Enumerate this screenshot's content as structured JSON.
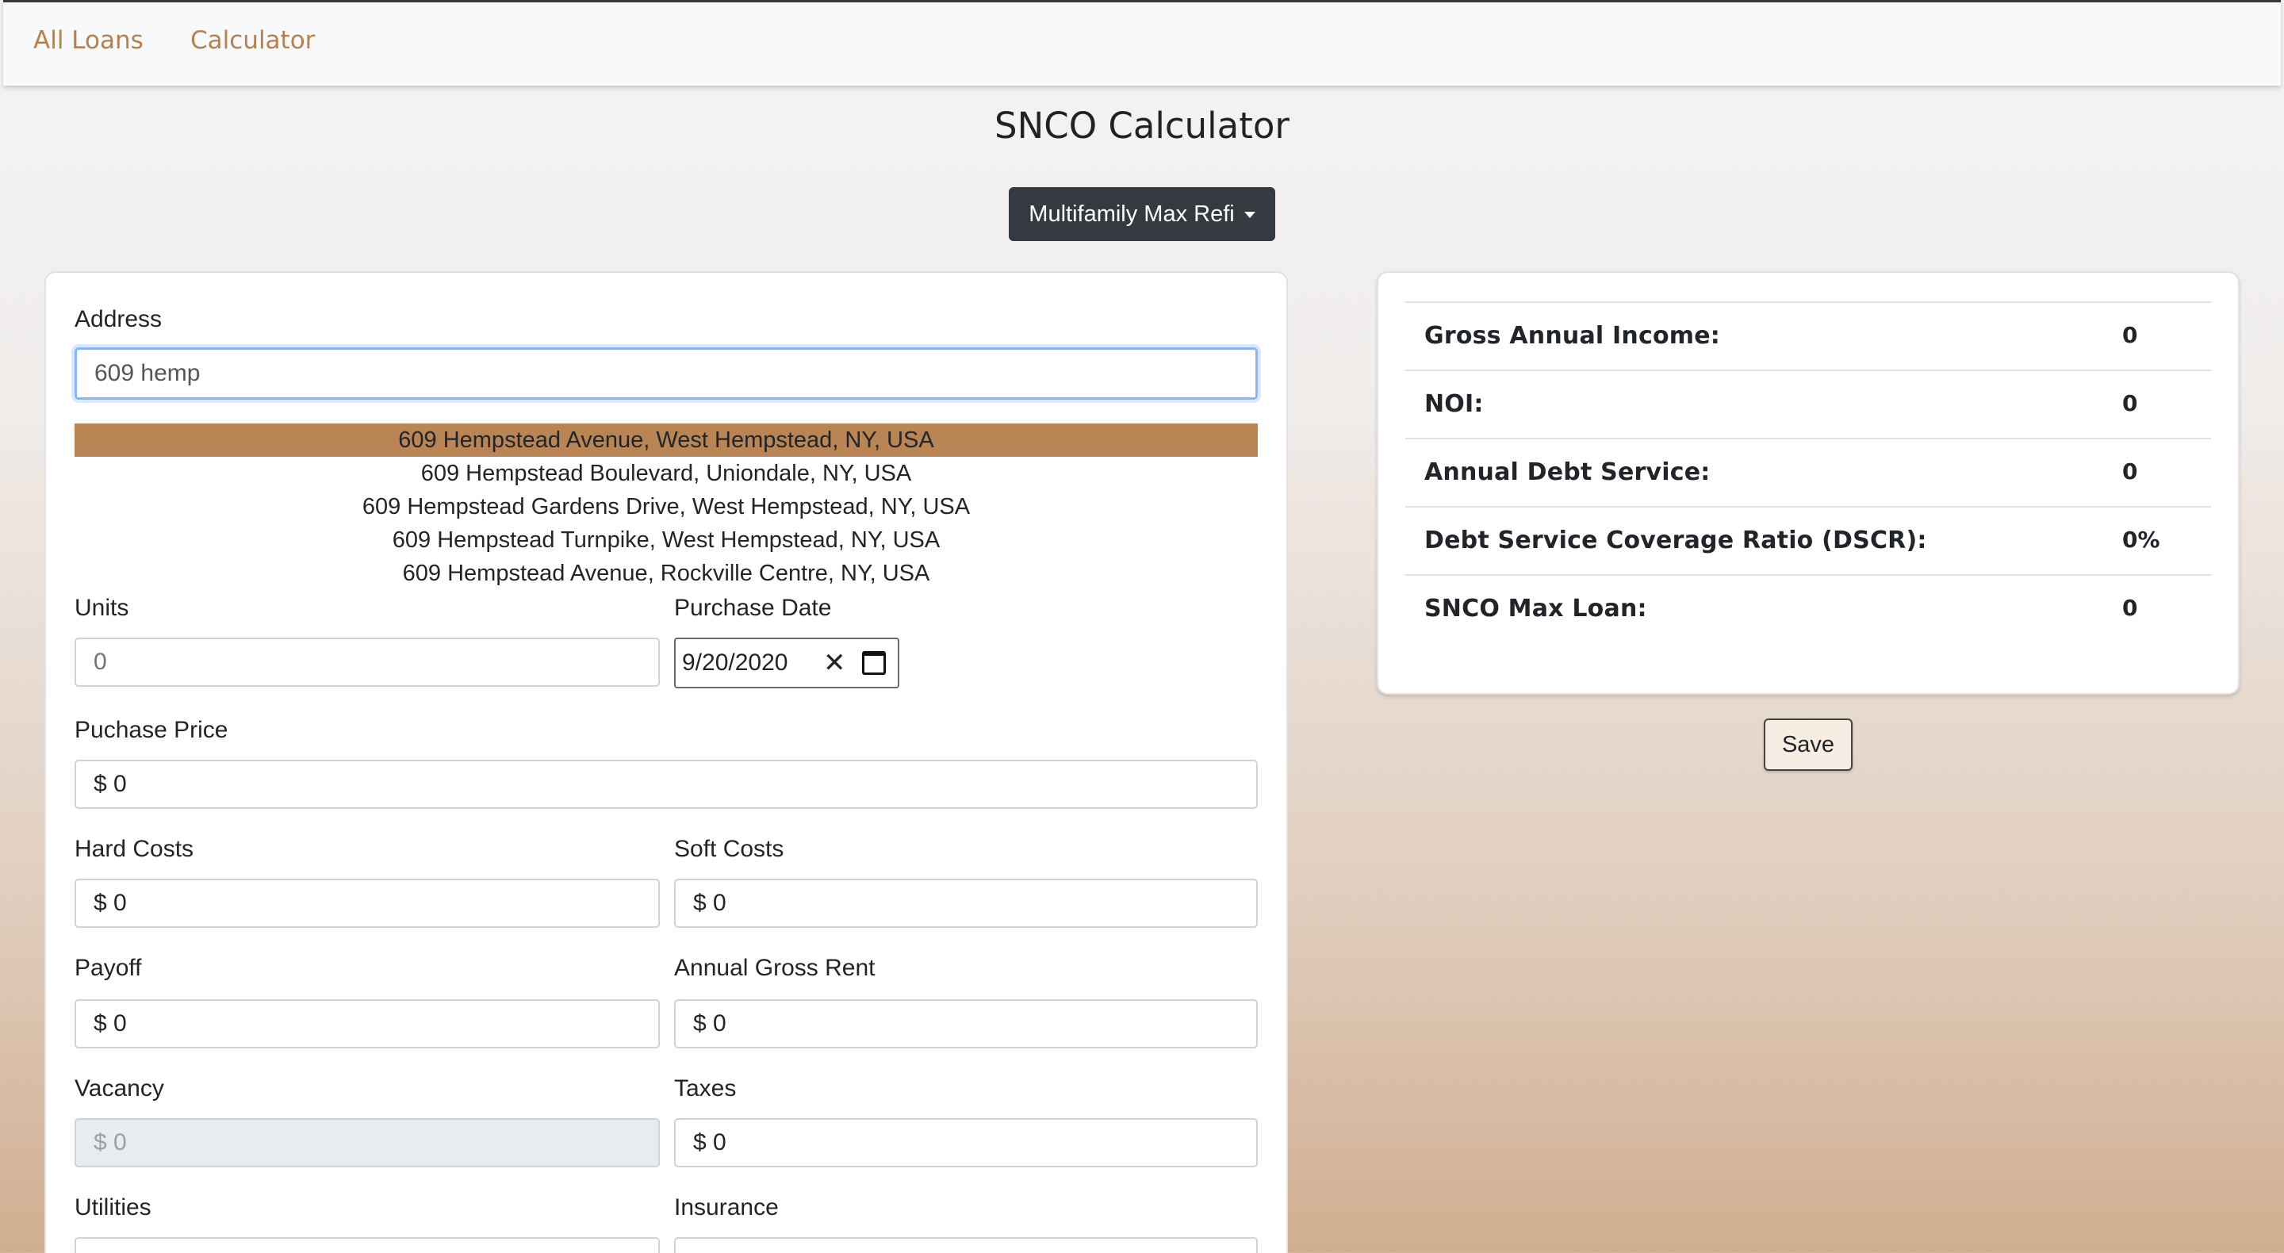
{
  "nav": {
    "items": [
      "All Loans",
      "Calculator"
    ]
  },
  "page": {
    "title": "SNCO Calculator"
  },
  "mode": {
    "label": "Multifamily Max Refi"
  },
  "form": {
    "address": {
      "label": "Address",
      "value": "609 hemp",
      "suggestions": [
        "609 Hempstead Avenue, West Hempstead, NY, USA",
        "609 Hempstead Boulevard, Uniondale, NY, USA",
        "609 Hempstead Gardens Drive, West Hempstead, NY, USA",
        "609 Hempstead Turnpike, West Hempstead, NY, USA",
        "609 Hempstead Avenue, Rockville Centre, NY, USA"
      ]
    },
    "units": {
      "label": "Units",
      "value": "0"
    },
    "purchase_date": {
      "label": "Purchase Date",
      "value": "9/20/2020"
    },
    "purchase_price": {
      "label": "Puchase Price",
      "value": "$ 0"
    },
    "hard_costs": {
      "label": "Hard Costs",
      "value": "$ 0"
    },
    "soft_costs": {
      "label": "Soft Costs",
      "value": "$ 0"
    },
    "payoff": {
      "label": "Payoff",
      "value": "$ 0"
    },
    "annual_gross_rent": {
      "label": "Annual Gross Rent",
      "value": "$ 0"
    },
    "vacancy": {
      "label": "Vacancy",
      "value": "$ 0"
    },
    "taxes": {
      "label": "Taxes",
      "value": "$ 0"
    },
    "utilities": {
      "label": "Utilities"
    },
    "insurance": {
      "label": "Insurance"
    }
  },
  "summary": {
    "rows": [
      {
        "label": "Gross Annual Income:",
        "value": "0"
      },
      {
        "label": "NOI:",
        "value": "0"
      },
      {
        "label": "Annual Debt Service:",
        "value": "0"
      },
      {
        "label": "Debt Service Coverage Ratio (DSCR):",
        "value": "0%"
      },
      {
        "label": "SNCO Max Loan:",
        "value": "0"
      }
    ]
  },
  "actions": {
    "save_label": "Save"
  },
  "colors": {
    "accent": "#b98555",
    "nav_link": "#b87f4f",
    "dark_button": "#343a40"
  }
}
